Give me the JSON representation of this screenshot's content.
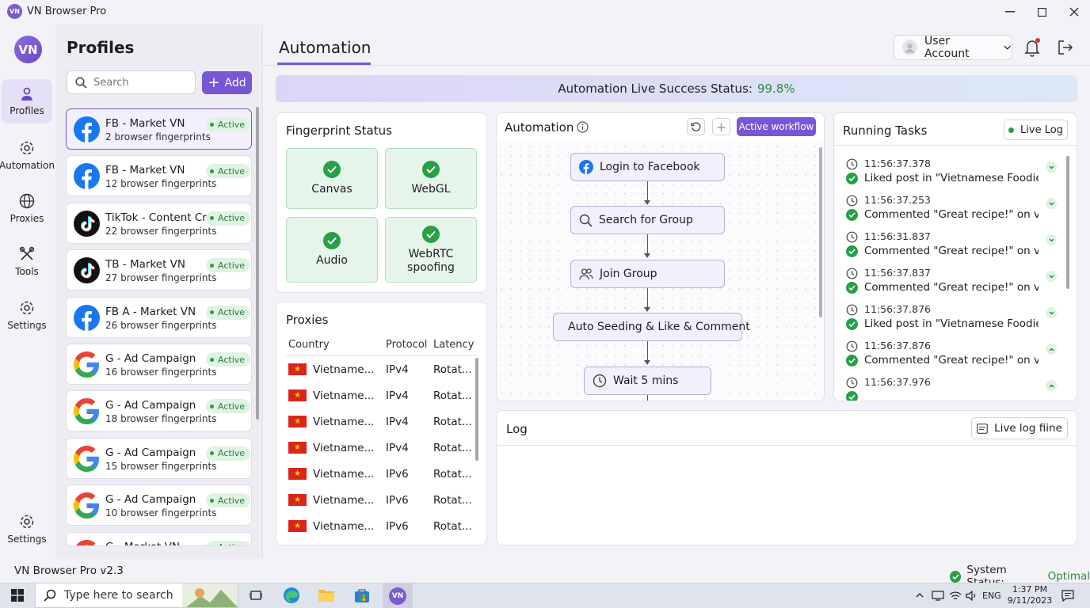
{
  "app": {
    "title": "VN Browser Pro",
    "logo": "VN",
    "version_label": "VN Browser Pro v2.3",
    "accent": "#7657d6"
  },
  "nav": {
    "items": [
      {
        "label": "Profiles",
        "icon": "profiles-icon",
        "active": true
      },
      {
        "label": "Automation",
        "icon": "gear-icon"
      },
      {
        "label": "Proxies",
        "icon": "globe-icon"
      },
      {
        "label": "Tools",
        "icon": "tools-icon"
      },
      {
        "label": "Settings",
        "icon": "gear-icon"
      }
    ],
    "bottom": {
      "label": "Settings",
      "icon": "gear-icon"
    }
  },
  "profiles": {
    "title": "Profiles",
    "search_placeholder": "Search",
    "add_label": "Add",
    "items": [
      {
        "name": "FB - Market VN",
        "sub": "2 browser fingerprints",
        "status": "Active",
        "icon": "facebook-icon"
      },
      {
        "name": "FB - Market VN",
        "sub": "12 browser fingerprints",
        "status": "Active",
        "icon": "facebook-icon"
      },
      {
        "name": "TikTok - Content Cre",
        "sub": "22 browser fingerprints",
        "status": "Active",
        "icon": "tiktok-icon"
      },
      {
        "name": "TB - Market VN",
        "sub": "27 browser fingerprints",
        "status": "Active",
        "icon": "tiktok-icon"
      },
      {
        "name": "FB A - Market VN",
        "sub": "26 browser fingerprints",
        "status": "Active",
        "icon": "facebook-icon"
      },
      {
        "name": "G - Ad Campaign",
        "sub": "16 browser fingerprints",
        "status": "Active",
        "icon": "google-icon"
      },
      {
        "name": "G - Ad Campaign",
        "sub": "18 browser fingerprints",
        "status": "Active",
        "icon": "google-icon"
      },
      {
        "name": "G - Ad Campaign",
        "sub": "15 browser fingerprints",
        "status": "Active",
        "icon": "google-icon"
      },
      {
        "name": "G - Ad Campaign",
        "sub": "10 browser fingerprints",
        "status": "Active",
        "icon": "google-icon"
      },
      {
        "name": "G - Market VN",
        "sub": "",
        "status": "Active",
        "icon": "google-icon"
      }
    ]
  },
  "header": {
    "title": "Automation",
    "user_label": "User Account"
  },
  "success": {
    "label": "Automation Live Success Status:",
    "value": "99.8%"
  },
  "fingerprint": {
    "title": "Fingerprint Status",
    "items": [
      "Canvas",
      "WebGL",
      "Audio",
      "WebRTC spoofing"
    ]
  },
  "proxies": {
    "title": "Proxies",
    "columns": [
      "Country",
      "Protocol",
      "Latency"
    ],
    "rows": [
      {
        "country": "Vietname...",
        "protocol": "IPv4",
        "latency": "Rotat..."
      },
      {
        "country": "Vietname...",
        "protocol": "IPv4",
        "latency": "Rotat..."
      },
      {
        "country": "Vietname...",
        "protocol": "IPv4",
        "latency": "Rotat..."
      },
      {
        "country": "Vietname...",
        "protocol": "IPv4",
        "latency": "Rotat..."
      },
      {
        "country": "Vietname...",
        "protocol": "IPv6",
        "latency": "Rotat..."
      },
      {
        "country": "Vietname...",
        "protocol": "IPv6",
        "latency": "Rotat..."
      },
      {
        "country": "Vietname...",
        "protocol": "IPv6",
        "latency": "Rotat..."
      }
    ]
  },
  "automation": {
    "title": "Automation",
    "active_label": "Active workflow",
    "nodes": [
      {
        "label": "Login to Facebook",
        "icon": "facebook-icon"
      },
      {
        "label": "Search for Group",
        "icon": "search-icon"
      },
      {
        "label": "Join Group",
        "icon": "users-icon"
      },
      {
        "label": "Auto Seeding & Like & Comment",
        "icon": "heart-icon"
      },
      {
        "label": "Wait 5 mins",
        "icon": "clock-icon"
      }
    ]
  },
  "tasks": {
    "title": "Running Tasks",
    "live_label": "Live Log",
    "items": [
      {
        "time": "11:56:37.378",
        "msg": "Liked post in \"Vietnamese Foodies\""
      },
      {
        "time": "11:56:37.253",
        "msg": "Commented \"Great recipe!\" on video..."
      },
      {
        "time": "11:56:31.837",
        "msg": "Commented \"Great recipe!\" on video..."
      },
      {
        "time": "11:56:37.837",
        "msg": "Commented \"Great recipe!\" on video..."
      },
      {
        "time": "11:56:37.876",
        "msg": "Liked post in \"Vietnamese Foodies\""
      },
      {
        "time": "11:56:37.876",
        "msg": "Commented \"Great recipe!\" on video..."
      },
      {
        "time": "11:56:37.976",
        "msg": ""
      }
    ]
  },
  "log": {
    "title": "Log",
    "btn_label": "Live log fiine"
  },
  "system": {
    "label": "System Status:",
    "value": "Optimal"
  },
  "taskbar": {
    "search": "Type here to search",
    "lang": "ENG",
    "time": "1:37 PM",
    "date": "9/11/2023"
  }
}
